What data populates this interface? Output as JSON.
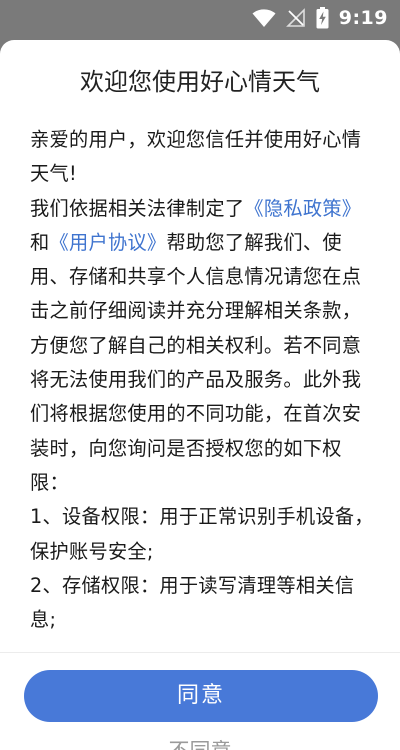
{
  "status_bar": {
    "time": "9:19",
    "icons": [
      "wifi-icon",
      "no-signal-icon",
      "battery-charging-icon"
    ]
  },
  "dialog": {
    "title": "欢迎您使用好心情天气",
    "greeting": "亲爱的用户，欢迎您信任并使用好心情天气!",
    "para_intro": "我们依据相关法律制定了",
    "privacy_link": "《隐私政策》",
    "and_text": "和",
    "user_agreement_link": "《用户协议》",
    "para_rest": "帮助您了解我们、使用、存储和共享个人信息情况请您在点击之前仔细阅读并充分理解相关条款，方便您了解自己的相关权利。若不同意将无法使用我们的产品及服务。此外我们将根据您使用的不同功能，在首次安装时，向您询问是否授权您的如下权限：",
    "perm_1": "1、设备权限：用于正常识别手机设备，保护账号安全;",
    "perm_2": "2、存储权限：用于读写清理等相关信息;",
    "agree_label": "同意",
    "disagree_label": "不同意"
  },
  "colors": {
    "link": "#3f74cf",
    "primary_button": "#4879d8",
    "scrim": "#7a7a7a"
  }
}
